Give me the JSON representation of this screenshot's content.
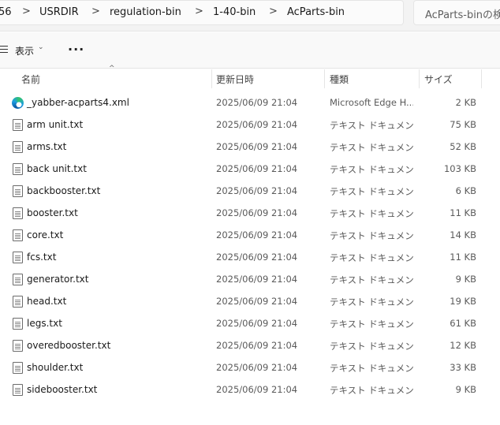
{
  "breadcrumb": {
    "items": [
      "56",
      "USRDIR",
      "regulation-bin",
      "1-40-bin",
      "AcParts-bin"
    ],
    "separator": ">"
  },
  "search": {
    "placeholder": "AcParts-binの検索"
  },
  "toolbar": {
    "view_label": "表示",
    "more_label": "..."
  },
  "columns": {
    "name": "名前",
    "date": "更新日時",
    "type": "種類",
    "size": "サイズ"
  },
  "files": [
    {
      "name": "_yabber-acparts4.xml",
      "date": "2025/06/09 21:04",
      "type": "Microsoft Edge H...",
      "size": "2 KB",
      "icon": "edge-icon"
    },
    {
      "name": "arm unit.txt",
      "date": "2025/06/09 21:04",
      "type": "テキスト ドキュメント",
      "size": "75 KB",
      "icon": "text-file-icon"
    },
    {
      "name": "arms.txt",
      "date": "2025/06/09 21:04",
      "type": "テキスト ドキュメント",
      "size": "52 KB",
      "icon": "text-file-icon"
    },
    {
      "name": "back unit.txt",
      "date": "2025/06/09 21:04",
      "type": "テキスト ドキュメント",
      "size": "103 KB",
      "icon": "text-file-icon"
    },
    {
      "name": "backbooster.txt",
      "date": "2025/06/09 21:04",
      "type": "テキスト ドキュメント",
      "size": "6 KB",
      "icon": "text-file-icon"
    },
    {
      "name": "booster.txt",
      "date": "2025/06/09 21:04",
      "type": "テキスト ドキュメント",
      "size": "11 KB",
      "icon": "text-file-icon"
    },
    {
      "name": "core.txt",
      "date": "2025/06/09 21:04",
      "type": "テキスト ドキュメント",
      "size": "14 KB",
      "icon": "text-file-icon"
    },
    {
      "name": "fcs.txt",
      "date": "2025/06/09 21:04",
      "type": "テキスト ドキュメント",
      "size": "11 KB",
      "icon": "text-file-icon"
    },
    {
      "name": "generator.txt",
      "date": "2025/06/09 21:04",
      "type": "テキスト ドキュメント",
      "size": "9 KB",
      "icon": "text-file-icon"
    },
    {
      "name": "head.txt",
      "date": "2025/06/09 21:04",
      "type": "テキスト ドキュメント",
      "size": "19 KB",
      "icon": "text-file-icon"
    },
    {
      "name": "legs.txt",
      "date": "2025/06/09 21:04",
      "type": "テキスト ドキュメント",
      "size": "61 KB",
      "icon": "text-file-icon"
    },
    {
      "name": "overedbooster.txt",
      "date": "2025/06/09 21:04",
      "type": "テキスト ドキュメント",
      "size": "12 KB",
      "icon": "text-file-icon"
    },
    {
      "name": "shoulder.txt",
      "date": "2025/06/09 21:04",
      "type": "テキスト ドキュメント",
      "size": "33 KB",
      "icon": "text-file-icon"
    },
    {
      "name": "sidebooster.txt",
      "date": "2025/06/09 21:04",
      "type": "テキスト ドキュメント",
      "size": "9 KB",
      "icon": "text-file-icon"
    }
  ]
}
